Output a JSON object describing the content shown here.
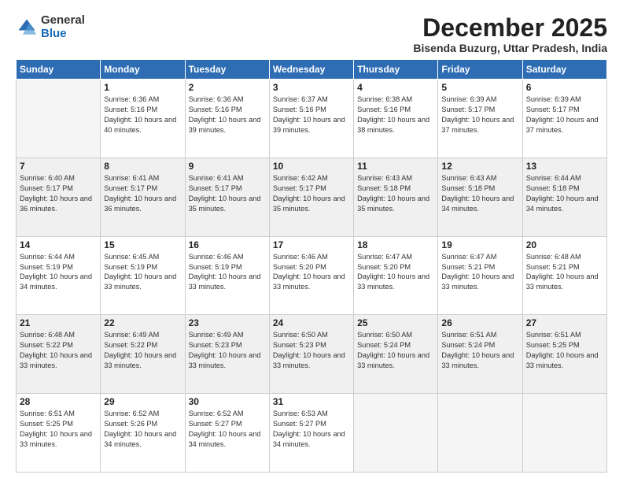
{
  "logo": {
    "general": "General",
    "blue": "Blue"
  },
  "header": {
    "month": "December 2025",
    "location": "Bisenda Buzurg, Uttar Pradesh, India"
  },
  "weekdays": [
    "Sunday",
    "Monday",
    "Tuesday",
    "Wednesday",
    "Thursday",
    "Friday",
    "Saturday"
  ],
  "weeks": [
    [
      {
        "day": "",
        "sunrise": "",
        "sunset": "",
        "daylight": "",
        "empty": true
      },
      {
        "day": "1",
        "sunrise": "Sunrise: 6:36 AM",
        "sunset": "Sunset: 5:16 PM",
        "daylight": "Daylight: 10 hours and 40 minutes."
      },
      {
        "day": "2",
        "sunrise": "Sunrise: 6:36 AM",
        "sunset": "Sunset: 5:16 PM",
        "daylight": "Daylight: 10 hours and 39 minutes."
      },
      {
        "day": "3",
        "sunrise": "Sunrise: 6:37 AM",
        "sunset": "Sunset: 5:16 PM",
        "daylight": "Daylight: 10 hours and 39 minutes."
      },
      {
        "day": "4",
        "sunrise": "Sunrise: 6:38 AM",
        "sunset": "Sunset: 5:16 PM",
        "daylight": "Daylight: 10 hours and 38 minutes."
      },
      {
        "day": "5",
        "sunrise": "Sunrise: 6:39 AM",
        "sunset": "Sunset: 5:17 PM",
        "daylight": "Daylight: 10 hours and 37 minutes."
      },
      {
        "day": "6",
        "sunrise": "Sunrise: 6:39 AM",
        "sunset": "Sunset: 5:17 PM",
        "daylight": "Daylight: 10 hours and 37 minutes."
      }
    ],
    [
      {
        "day": "7",
        "sunrise": "Sunrise: 6:40 AM",
        "sunset": "Sunset: 5:17 PM",
        "daylight": "Daylight: 10 hours and 36 minutes."
      },
      {
        "day": "8",
        "sunrise": "Sunrise: 6:41 AM",
        "sunset": "Sunset: 5:17 PM",
        "daylight": "Daylight: 10 hours and 36 minutes."
      },
      {
        "day": "9",
        "sunrise": "Sunrise: 6:41 AM",
        "sunset": "Sunset: 5:17 PM",
        "daylight": "Daylight: 10 hours and 35 minutes."
      },
      {
        "day": "10",
        "sunrise": "Sunrise: 6:42 AM",
        "sunset": "Sunset: 5:17 PM",
        "daylight": "Daylight: 10 hours and 35 minutes."
      },
      {
        "day": "11",
        "sunrise": "Sunrise: 6:43 AM",
        "sunset": "Sunset: 5:18 PM",
        "daylight": "Daylight: 10 hours and 35 minutes."
      },
      {
        "day": "12",
        "sunrise": "Sunrise: 6:43 AM",
        "sunset": "Sunset: 5:18 PM",
        "daylight": "Daylight: 10 hours and 34 minutes."
      },
      {
        "day": "13",
        "sunrise": "Sunrise: 6:44 AM",
        "sunset": "Sunset: 5:18 PM",
        "daylight": "Daylight: 10 hours and 34 minutes."
      }
    ],
    [
      {
        "day": "14",
        "sunrise": "Sunrise: 6:44 AM",
        "sunset": "Sunset: 5:19 PM",
        "daylight": "Daylight: 10 hours and 34 minutes."
      },
      {
        "day": "15",
        "sunrise": "Sunrise: 6:45 AM",
        "sunset": "Sunset: 5:19 PM",
        "daylight": "Daylight: 10 hours and 33 minutes."
      },
      {
        "day": "16",
        "sunrise": "Sunrise: 6:46 AM",
        "sunset": "Sunset: 5:19 PM",
        "daylight": "Daylight: 10 hours and 33 minutes."
      },
      {
        "day": "17",
        "sunrise": "Sunrise: 6:46 AM",
        "sunset": "Sunset: 5:20 PM",
        "daylight": "Daylight: 10 hours and 33 minutes."
      },
      {
        "day": "18",
        "sunrise": "Sunrise: 6:47 AM",
        "sunset": "Sunset: 5:20 PM",
        "daylight": "Daylight: 10 hours and 33 minutes."
      },
      {
        "day": "19",
        "sunrise": "Sunrise: 6:47 AM",
        "sunset": "Sunset: 5:21 PM",
        "daylight": "Daylight: 10 hours and 33 minutes."
      },
      {
        "day": "20",
        "sunrise": "Sunrise: 6:48 AM",
        "sunset": "Sunset: 5:21 PM",
        "daylight": "Daylight: 10 hours and 33 minutes."
      }
    ],
    [
      {
        "day": "21",
        "sunrise": "Sunrise: 6:48 AM",
        "sunset": "Sunset: 5:22 PM",
        "daylight": "Daylight: 10 hours and 33 minutes."
      },
      {
        "day": "22",
        "sunrise": "Sunrise: 6:49 AM",
        "sunset": "Sunset: 5:22 PM",
        "daylight": "Daylight: 10 hours and 33 minutes."
      },
      {
        "day": "23",
        "sunrise": "Sunrise: 6:49 AM",
        "sunset": "Sunset: 5:23 PM",
        "daylight": "Daylight: 10 hours and 33 minutes."
      },
      {
        "day": "24",
        "sunrise": "Sunrise: 6:50 AM",
        "sunset": "Sunset: 5:23 PM",
        "daylight": "Daylight: 10 hours and 33 minutes."
      },
      {
        "day": "25",
        "sunrise": "Sunrise: 6:50 AM",
        "sunset": "Sunset: 5:24 PM",
        "daylight": "Daylight: 10 hours and 33 minutes."
      },
      {
        "day": "26",
        "sunrise": "Sunrise: 6:51 AM",
        "sunset": "Sunset: 5:24 PM",
        "daylight": "Daylight: 10 hours and 33 minutes."
      },
      {
        "day": "27",
        "sunrise": "Sunrise: 6:51 AM",
        "sunset": "Sunset: 5:25 PM",
        "daylight": "Daylight: 10 hours and 33 minutes."
      }
    ],
    [
      {
        "day": "28",
        "sunrise": "Sunrise: 6:51 AM",
        "sunset": "Sunset: 5:25 PM",
        "daylight": "Daylight: 10 hours and 33 minutes."
      },
      {
        "day": "29",
        "sunrise": "Sunrise: 6:52 AM",
        "sunset": "Sunset: 5:26 PM",
        "daylight": "Daylight: 10 hours and 34 minutes."
      },
      {
        "day": "30",
        "sunrise": "Sunrise: 6:52 AM",
        "sunset": "Sunset: 5:27 PM",
        "daylight": "Daylight: 10 hours and 34 minutes."
      },
      {
        "day": "31",
        "sunrise": "Sunrise: 6:53 AM",
        "sunset": "Sunset: 5:27 PM",
        "daylight": "Daylight: 10 hours and 34 minutes."
      },
      {
        "day": "",
        "sunrise": "",
        "sunset": "",
        "daylight": "",
        "empty": true
      },
      {
        "day": "",
        "sunrise": "",
        "sunset": "",
        "daylight": "",
        "empty": true
      },
      {
        "day": "",
        "sunrise": "",
        "sunset": "",
        "daylight": "",
        "empty": true
      }
    ]
  ]
}
